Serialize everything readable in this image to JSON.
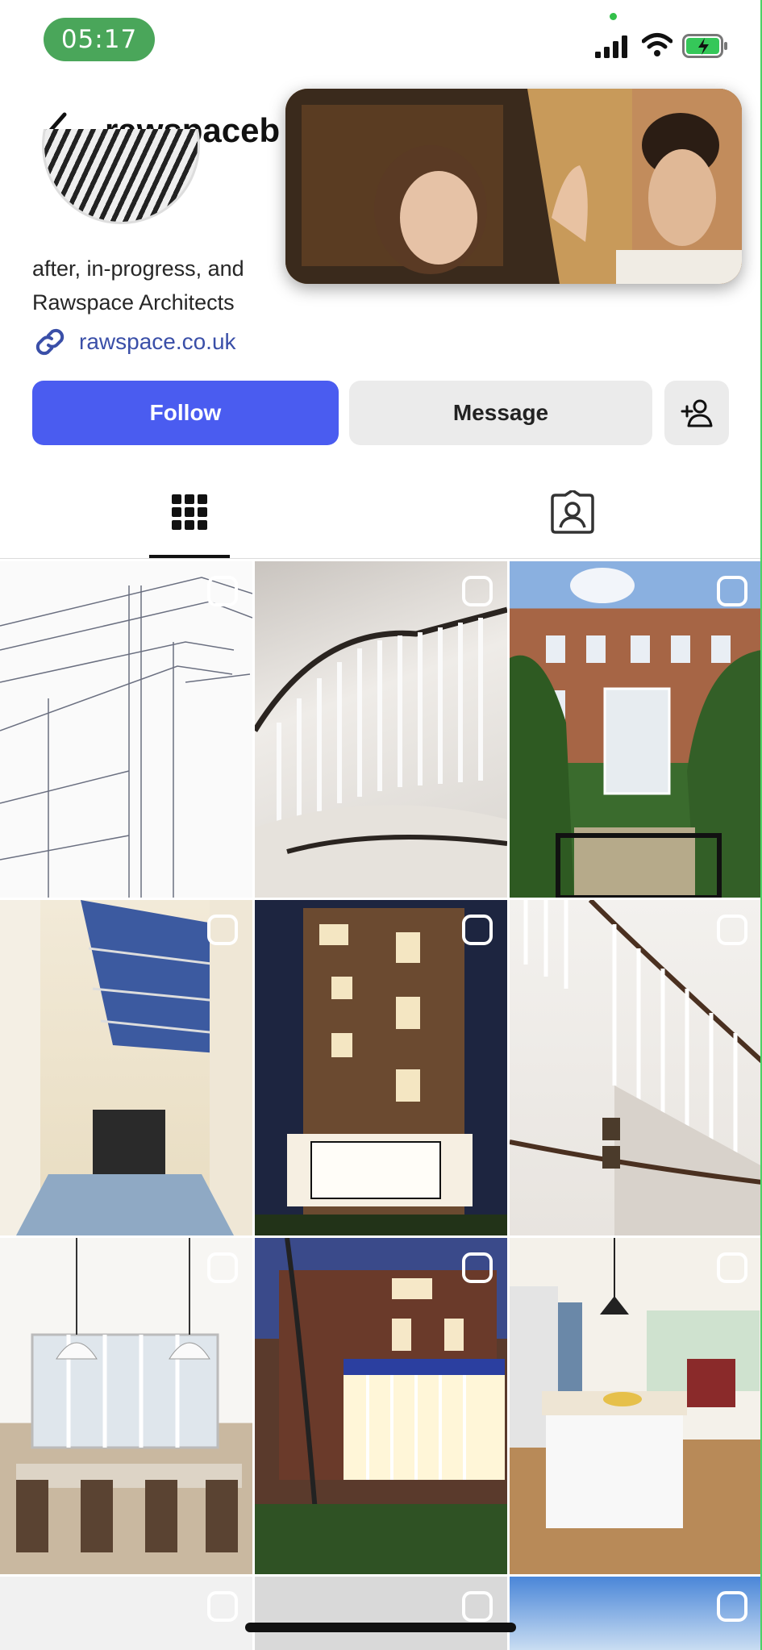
{
  "status_bar": {
    "time": "05:17",
    "signal_icon": "cellular-signal-icon",
    "wifi_icon": "wifi-icon",
    "battery_icon": "battery-charging-icon"
  },
  "profile": {
    "username": "rawspaceb",
    "bio_line1": "after, in-progress, and",
    "bio_line2": "Rawspace Architects",
    "website": "rawspace.co.uk"
  },
  "actions": {
    "follow_label": "Follow",
    "message_label": "Message",
    "add_icon": "person-add-icon"
  },
  "tabs": [
    {
      "name": "grid",
      "icon": "grid-icon",
      "active": true
    },
    {
      "name": "tagged",
      "icon": "tagged-person-icon",
      "active": false
    }
  ],
  "grid": {
    "posts": [
      {
        "subject": "architectural sketch"
      },
      {
        "subject": "white staircase"
      },
      {
        "subject": "brick townhouse garden"
      },
      {
        "subject": "glass roof atrium"
      },
      {
        "subject": "brick house at night"
      },
      {
        "subject": "staircase with dark handrail"
      },
      {
        "subject": "dining room with pendant lights"
      },
      {
        "subject": "house at dusk"
      },
      {
        "subject": "kitchen island"
      },
      {
        "subject": "partial post"
      },
      {
        "subject": "partial post"
      },
      {
        "subject": "partial post sky"
      }
    ]
  },
  "colors": {
    "follow_blue": "#4a5cf0",
    "link_blue": "#3a4fa8",
    "time_pill_green": "#4aa65a"
  }
}
